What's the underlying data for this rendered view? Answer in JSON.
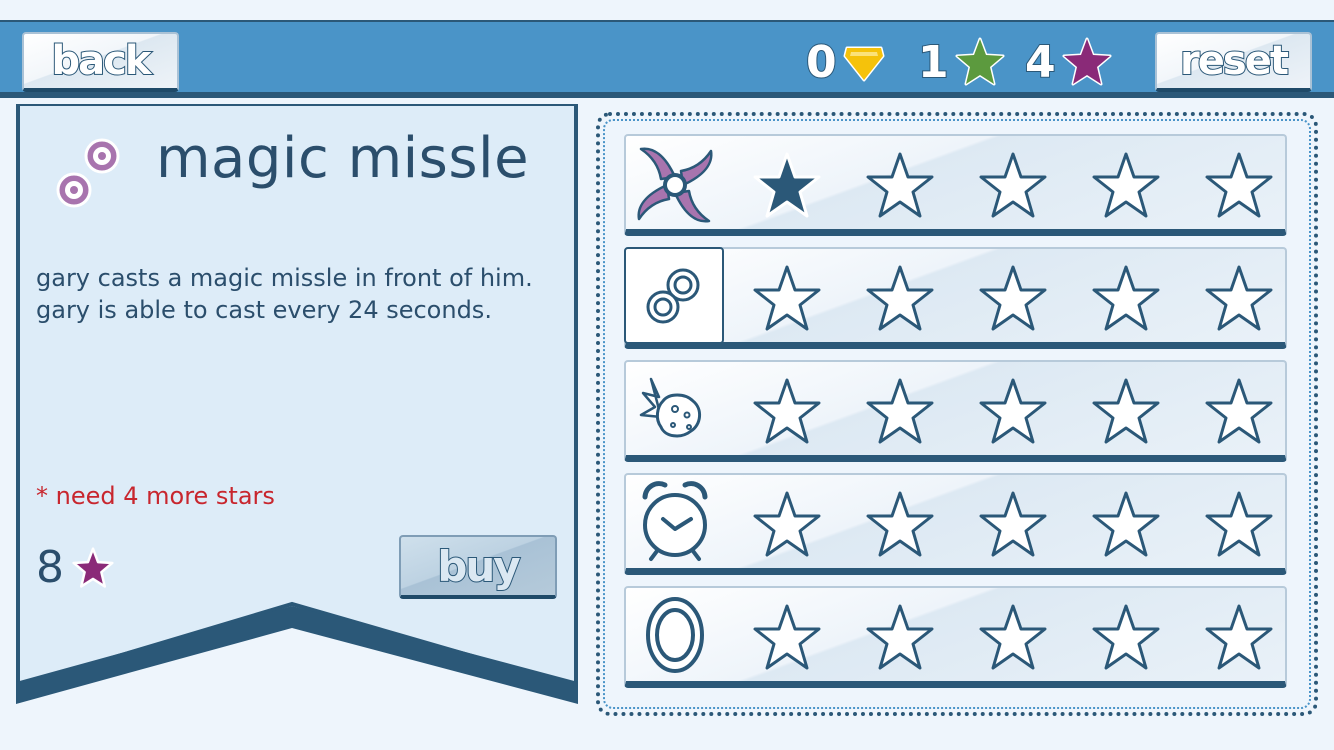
{
  "topbar": {
    "back_label": "back",
    "reset_label": "reset",
    "gems": "0",
    "green_stars": "1",
    "purple_stars": "4"
  },
  "detail": {
    "title": "magic missle",
    "description_line1": "gary casts a magic missle in front of him.",
    "description_line2": "gary is able to cast every 24 seconds.",
    "requirement": "* need 4 more stars",
    "cost": "8",
    "buy_label": "buy"
  },
  "skills": [
    {
      "icon": "shuriken-icon",
      "filled_stars": 1,
      "total_stars": 5,
      "selected": false
    },
    {
      "icon": "magic-missile-icon",
      "filled_stars": 0,
      "total_stars": 5,
      "selected": true
    },
    {
      "icon": "meteor-icon",
      "filled_stars": 0,
      "total_stars": 5,
      "selected": false
    },
    {
      "icon": "alarm-clock-icon",
      "filled_stars": 0,
      "total_stars": 5,
      "selected": false
    },
    {
      "icon": "shield-ring-icon",
      "filled_stars": 0,
      "total_stars": 5,
      "selected": false
    }
  ],
  "colors": {
    "topbar": "#4a94c8",
    "dark": "#2b5878",
    "gem": "#f5c20b",
    "green_star": "#5c9a3e",
    "purple_star": "#8a2a78",
    "warning": "#c8262e"
  }
}
